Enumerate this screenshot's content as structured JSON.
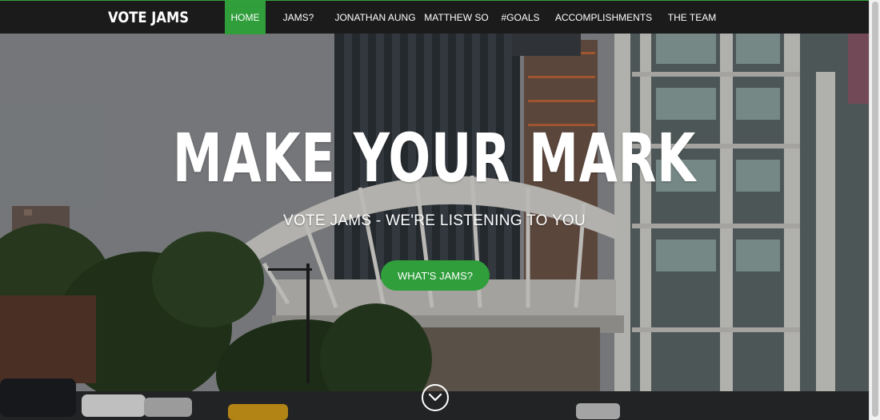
{
  "brand": {
    "name": "VOTE JAMS"
  },
  "nav": {
    "items": [
      {
        "label": "HOME",
        "active": true
      },
      {
        "label": "JAMS?"
      },
      {
        "label": "JONATHAN AUNG"
      },
      {
        "label": "MATTHEW SO"
      },
      {
        "label": "#GOALS"
      },
      {
        "label": "ACCOMPLISHMENTS"
      },
      {
        "label": "THE TEAM"
      }
    ]
  },
  "hero": {
    "headline": "MAKE YOUR MARK",
    "subheadline": "VOTE JAMS - WE'RE LISTENING TO YOU",
    "cta_label": "WHAT'S JAMS?",
    "scroll_icon": "chevron-down-circle-icon"
  },
  "colors": {
    "accent": "#2f9e3b",
    "navbar_bg": "#1b1b1b",
    "text": "#ffffff"
  }
}
